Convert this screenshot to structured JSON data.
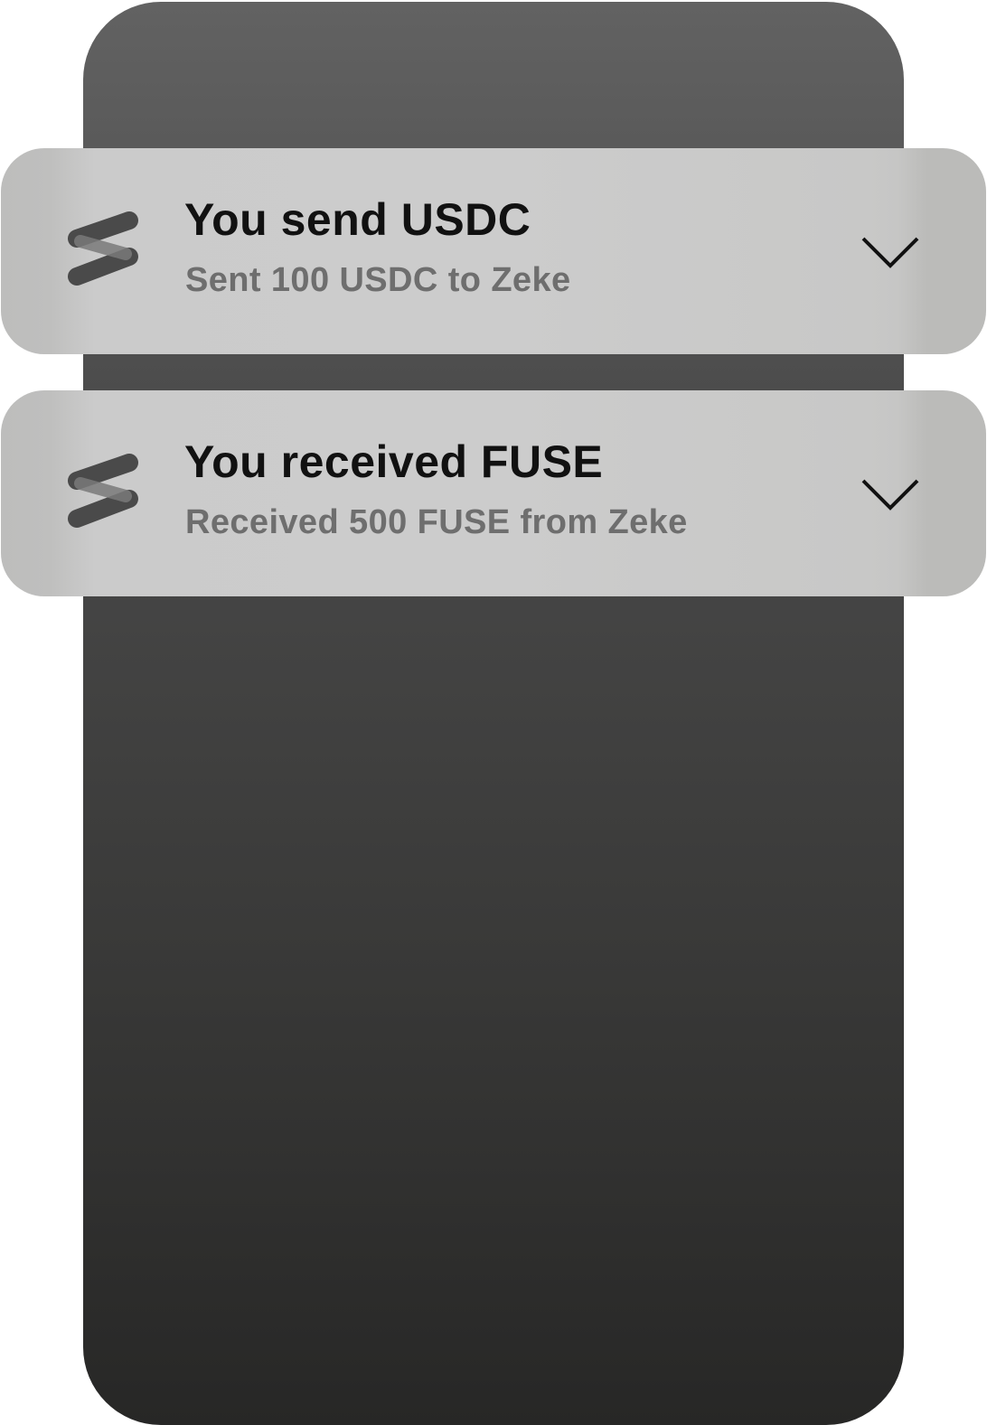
{
  "notifications": [
    {
      "title": "You send USDC",
      "message": "Sent 100 USDC to Zeke",
      "icon": "fuse-logo-icon",
      "action_icon": "chevron-down-icon"
    },
    {
      "title": "You received FUSE",
      "message": "Received 500 FUSE from Zeke",
      "icon": "fuse-logo-icon",
      "action_icon": "chevron-down-icon"
    }
  ],
  "colors": {
    "phone_top": "#626262",
    "phone_bottom": "#272726",
    "card": "#cccccc",
    "title": "#111111",
    "message": "#6e6e6e",
    "logo": "#4a4a4a"
  }
}
